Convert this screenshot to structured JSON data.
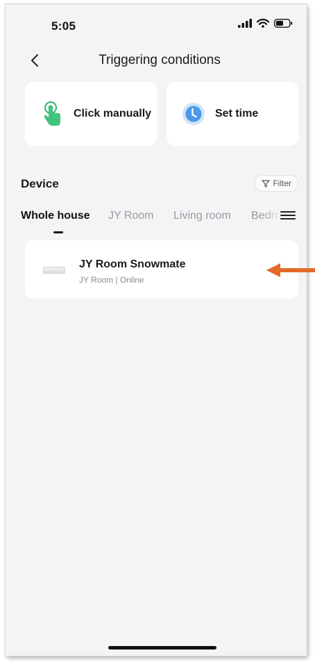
{
  "status_bar": {
    "time": "5:05"
  },
  "nav": {
    "title": "Triggering conditions"
  },
  "options": [
    {
      "label": "Click manually",
      "icon": "hand-tap-icon"
    },
    {
      "label": "Set time",
      "icon": "clock-icon"
    }
  ],
  "device_section": {
    "title": "Device",
    "filter_label": "Filter"
  },
  "tabs": [
    {
      "label": "Whole house",
      "active": true
    },
    {
      "label": "JY Room"
    },
    {
      "label": "Living room"
    },
    {
      "label": "Bedro"
    }
  ],
  "devices": [
    {
      "name": "JY Room Snowmate",
      "status": "JY Room | Online"
    }
  ],
  "colors": {
    "annotation_arrow": "#e36a2a",
    "clock_blue": "#3f8fe0",
    "tap_green": "#2fb36d"
  }
}
